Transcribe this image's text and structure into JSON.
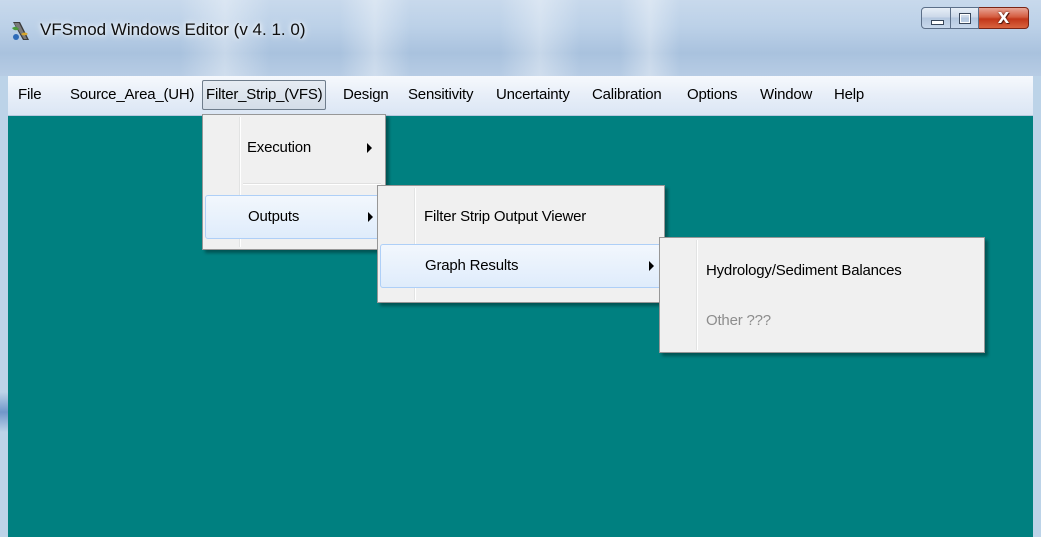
{
  "window": {
    "title": "VFSmod Windows Editor (v 4. 1. 0)",
    "close_glyph": "X"
  },
  "menubar": {
    "items": [
      {
        "label": "File"
      },
      {
        "label": "Source_Area_(UH)"
      },
      {
        "label": "Filter_Strip_(VFS)"
      },
      {
        "label": "Design"
      },
      {
        "label": "Sensitivity"
      },
      {
        "label": "Uncertainty"
      },
      {
        "label": "Calibration"
      },
      {
        "label": "Options"
      },
      {
        "label": "Window"
      },
      {
        "label": "Help"
      }
    ]
  },
  "filter_strip_menu": {
    "items": [
      {
        "label": "Execution",
        "has_submenu": true
      },
      {
        "label": "Outputs",
        "has_submenu": true,
        "highlighted": true
      }
    ]
  },
  "outputs_menu": {
    "items": [
      {
        "label": "Filter Strip Output Viewer",
        "has_submenu": false
      },
      {
        "label": "Graph Results",
        "has_submenu": true,
        "highlighted": true
      }
    ]
  },
  "graph_results_menu": {
    "items": [
      {
        "label": "Hydrology/Sediment Balances",
        "enabled": true
      },
      {
        "label": "Other ???",
        "enabled": false
      }
    ]
  },
  "colors": {
    "client_background": "#008080",
    "menu_background": "#f0f0f0",
    "menu_highlight_border": "#aecff7",
    "disabled_text": "#8d8d8d",
    "close_button": "#c2361a"
  },
  "icons": {
    "app": "vfsmod-app-icon",
    "minimize": "minimize-icon",
    "maximize": "maximize-icon",
    "close": "close-icon",
    "submenu": "chevron-right-icon"
  }
}
